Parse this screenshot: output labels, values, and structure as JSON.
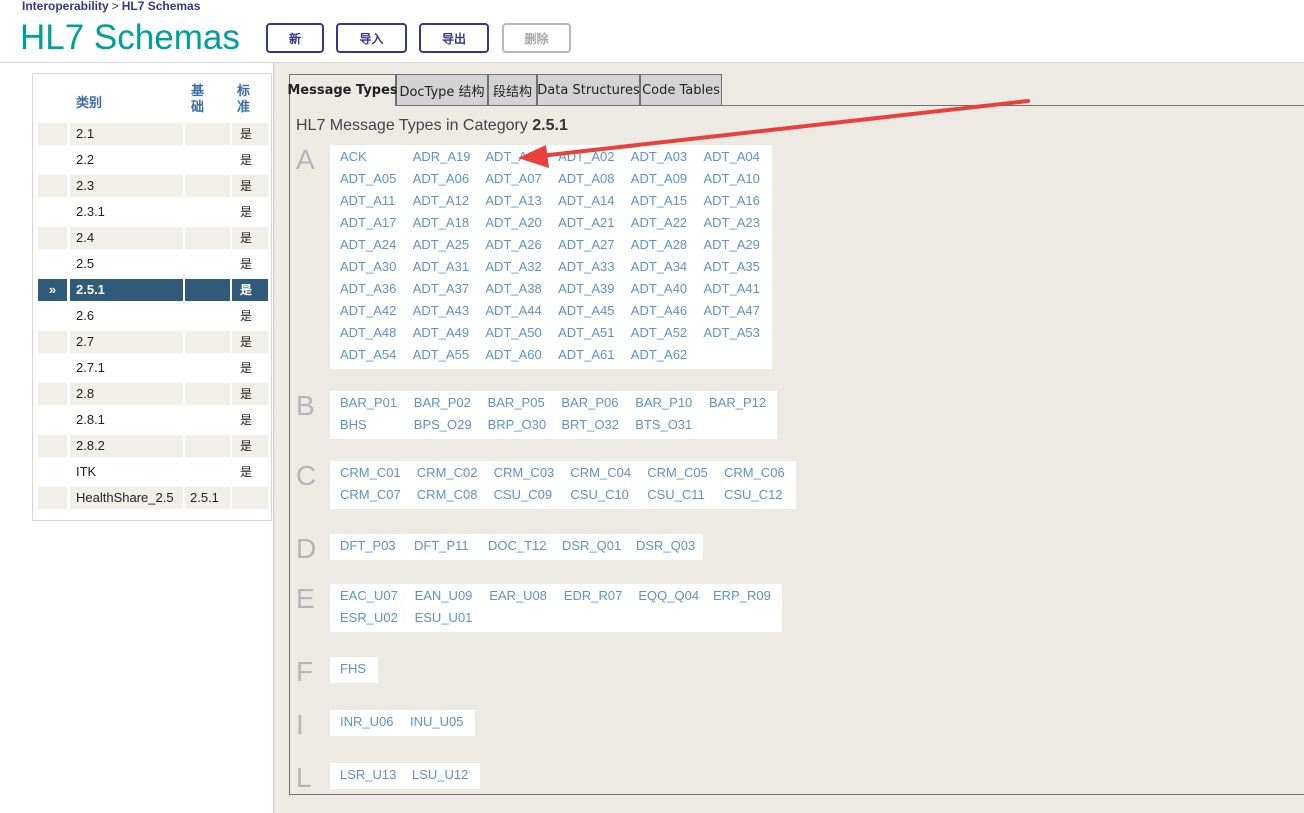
{
  "breadcrumb": {
    "root": "Interoperability",
    "sep": ">",
    "current": "HL7 Schemas"
  },
  "page_title": "HL7 Schemas",
  "toolbar": {
    "new_label": "新",
    "import_label": "导入",
    "export_label": "导出",
    "delete_label": "删除"
  },
  "categories": {
    "headers": {
      "category": "类别",
      "base": "基础",
      "standard": "标准"
    },
    "rows": [
      {
        "name": "2.1",
        "base": "",
        "standard": "是"
      },
      {
        "name": "2.2",
        "base": "",
        "standard": "是"
      },
      {
        "name": "2.3",
        "base": "",
        "standard": "是"
      },
      {
        "name": "2.3.1",
        "base": "",
        "standard": "是"
      },
      {
        "name": "2.4",
        "base": "",
        "standard": "是"
      },
      {
        "name": "2.5",
        "base": "",
        "standard": "是"
      },
      {
        "name": "2.5.1",
        "base": "",
        "standard": "是",
        "selected": true,
        "marker": "»"
      },
      {
        "name": "2.6",
        "base": "",
        "standard": "是"
      },
      {
        "name": "2.7",
        "base": "",
        "standard": "是"
      },
      {
        "name": "2.7.1",
        "base": "",
        "standard": "是"
      },
      {
        "name": "2.8",
        "base": "",
        "standard": "是"
      },
      {
        "name": "2.8.1",
        "base": "",
        "standard": "是"
      },
      {
        "name": "2.8.2",
        "base": "",
        "standard": "是"
      },
      {
        "name": "ITK",
        "base": "",
        "standard": "是"
      },
      {
        "name": "HealthShare_2.5",
        "base": "2.5.1",
        "standard": ""
      }
    ]
  },
  "tabs": [
    {
      "label": "Message Types",
      "active": true
    },
    {
      "label": "DocType 结构"
    },
    {
      "label": "段结构"
    },
    {
      "label": "Data Structures"
    },
    {
      "label": "Code Tables"
    }
  ],
  "panel": {
    "title_prefix": "HL7 Message Types in Category",
    "category": "2.5.1"
  },
  "groups": [
    {
      "letter": "A",
      "items": [
        "ACK",
        "ADR_A19",
        "ADT_A01",
        "ADT_A02",
        "ADT_A03",
        "ADT_A04",
        "ADT_A05",
        "ADT_A06",
        "ADT_A07",
        "ADT_A08",
        "ADT_A09",
        "ADT_A10",
        "ADT_A11",
        "ADT_A12",
        "ADT_A13",
        "ADT_A14",
        "ADT_A15",
        "ADT_A16",
        "ADT_A17",
        "ADT_A18",
        "ADT_A20",
        "ADT_A21",
        "ADT_A22",
        "ADT_A23",
        "ADT_A24",
        "ADT_A25",
        "ADT_A26",
        "ADT_A27",
        "ADT_A28",
        "ADT_A29",
        "ADT_A30",
        "ADT_A31",
        "ADT_A32",
        "ADT_A33",
        "ADT_A34",
        "ADT_A35",
        "ADT_A36",
        "ADT_A37",
        "ADT_A38",
        "ADT_A39",
        "ADT_A40",
        "ADT_A41",
        "ADT_A42",
        "ADT_A43",
        "ADT_A44",
        "ADT_A45",
        "ADT_A46",
        "ADT_A47",
        "ADT_A48",
        "ADT_A49",
        "ADT_A50",
        "ADT_A51",
        "ADT_A52",
        "ADT_A53",
        "ADT_A54",
        "ADT_A55",
        "ADT_A60",
        "ADT_A61",
        "ADT_A62"
      ]
    },
    {
      "letter": "B",
      "items": [
        "BAR_P01",
        "BAR_P02",
        "BAR_P05",
        "BAR_P06",
        "BAR_P10",
        "BAR_P12",
        "BHS",
        "BPS_O29",
        "BRP_O30",
        "BRT_O32",
        "BTS_O31"
      ]
    },
    {
      "letter": "C",
      "items": [
        "CRM_C01",
        "CRM_C02",
        "CRM_C03",
        "CRM_C04",
        "CRM_C05",
        "CRM_C06",
        "CRM_C07",
        "CRM_C08",
        "CSU_C09",
        "CSU_C10",
        "CSU_C11",
        "CSU_C12"
      ]
    },
    {
      "letter": "D",
      "items": [
        "DFT_P03",
        "DFT_P11",
        "DOC_T12",
        "DSR_Q01",
        "DSR_Q03"
      ]
    },
    {
      "letter": "E",
      "items": [
        "EAC_U07",
        "EAN_U09",
        "EAR_U08",
        "EDR_R07",
        "EQQ_Q04",
        "ERP_R09",
        "ESR_U02",
        "ESU_U01"
      ]
    },
    {
      "letter": "F",
      "items": [
        "FHS"
      ]
    },
    {
      "letter": "I",
      "items": [
        "INR_U06",
        "INU_U05"
      ]
    },
    {
      "letter": "L",
      "items": [
        "LSR_U13",
        "LSU_U12"
      ]
    }
  ],
  "colors": {
    "accent": "#00a09a",
    "brand": "#333695",
    "link": "#5b93cc",
    "selected_row": "#305b7a",
    "annotation_arrow": "#e8413c"
  }
}
